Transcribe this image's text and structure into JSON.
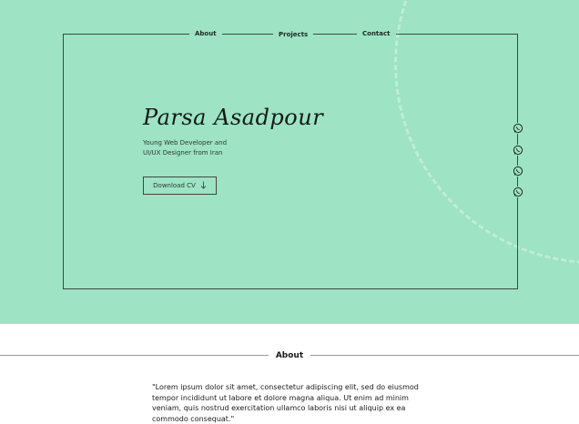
{
  "theme": {
    "hero_bg": "#9de3c4",
    "accent": "#9de3c4"
  },
  "nav": {
    "about": "About",
    "projects": "Projects",
    "contact": "Contact"
  },
  "hero": {
    "name": "Parsa Asadpour",
    "tagline_line1": "Young Web Developer and",
    "tagline_line2": "UI/UX Designer from Iran",
    "cv_button": "Download CV",
    "cv_icon": "arrow-down-icon"
  },
  "social": {
    "icons": [
      "whatsapp-icon",
      "whatsapp-icon",
      "whatsapp-icon",
      "whatsapp-icon"
    ]
  },
  "about": {
    "title": "About",
    "text": "\"Lorem ipsum dolor sit amet, consectetur adipiscing elit, sed do eiusmod tempor incididunt ut labore et dolore magna aliqua. Ut enim ad minim veniam, quis nostrud exercitation ullamco laboris nisi ut aliquip ex ea commodo consequat.\""
  }
}
